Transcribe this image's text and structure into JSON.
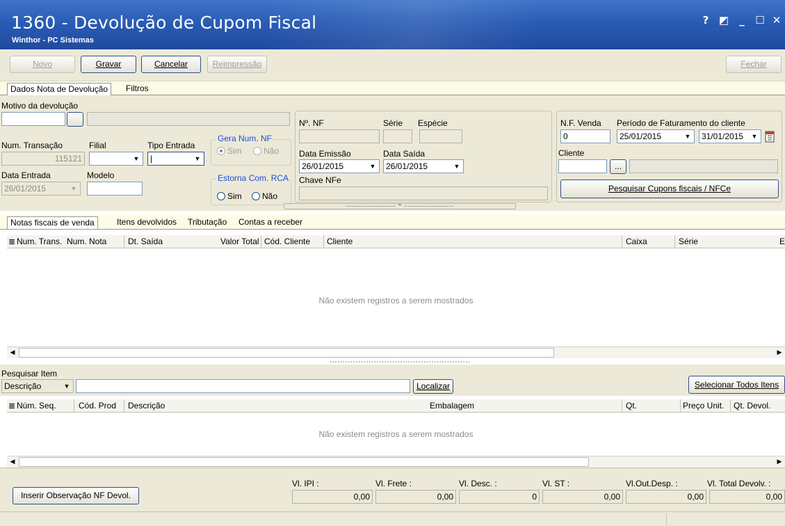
{
  "window": {
    "title": "1360 - Devolução de Cupom Fiscal",
    "subtitle": "Winthor - PC Sistemas",
    "controls": [
      "?",
      "◩",
      "_",
      "☐",
      "✕"
    ]
  },
  "toolbar": {
    "novo": "Novo",
    "gravar": "Gravar",
    "cancelar": "Cancelar",
    "reimpressao": "Reimpressão",
    "fechar": "Fechar"
  },
  "top_tabs": [
    "Dados Nota de Devolução",
    "Filtros"
  ],
  "form": {
    "motivo_label": "Motivo da devolução",
    "num_transacao_label": "Num. Transação",
    "num_transacao_value": "115121",
    "filial_label": "Filial",
    "tipo_entrada_label": "Tipo Entrada",
    "data_entrada_label": "Data Entrada",
    "data_entrada_value": "26/01/2015",
    "modelo_label": "Modelo",
    "gera_num_nf": {
      "legend": "Gera Num. NF",
      "sim": "Sim",
      "nao": "Não"
    },
    "estorna_com_rca": {
      "legend": "Estorna Com. RCA",
      "sim": "Sim",
      "nao": "Não"
    },
    "nf_label": "Nº. NF",
    "serie_label": "Série",
    "especie_label": "Espécie",
    "data_emissao_label": "Data Emissão",
    "data_emissao_value": "26/01/2015",
    "data_saida_label": "Data Saída",
    "data_saida_value": "26/01/2015",
    "chave_nfe_label": "Chave NFe",
    "nf_venda_label": "N.F. Venda",
    "nf_venda_value": "0",
    "periodo_label": "Período de Faturamento do cliente",
    "periodo_inicio": "25/01/2015",
    "periodo_fim": "31/01/2015",
    "cliente_label": "Cliente",
    "ellipsis": "...",
    "pesquisar_cupons": "Pesquisar Cupons fiscais / NFCe"
  },
  "lower_tabs": [
    "Notas fiscais de venda",
    "Itens devolvidos",
    "Tributação",
    "Contas a receber"
  ],
  "grid1": {
    "columns": [
      "Num. Trans.",
      "Num. Nota",
      "Dt. Saída",
      "Valor Total",
      "Cód. Cliente",
      "Cliente",
      "Caixa",
      "Série",
      "E"
    ],
    "empty_text": "Não existem registros a serem mostrados"
  },
  "search": {
    "label": "Pesquisar Item",
    "field_select": "Descrição",
    "localizar": "Localizar",
    "selecionar_todos": "Selecionar Todos Itens"
  },
  "grid2": {
    "columns": [
      "Núm. Seq.",
      "Cód. Prod",
      "Descrição",
      "Embalagem",
      "Qt.",
      "Preço Unit.",
      "Qt. Devol."
    ],
    "empty_text": "Não existem registros a serem mostrados"
  },
  "footer": {
    "inserir_obs": "Inserir Observação NF Devol.",
    "vl_ipi_label": "Vl. IPI :",
    "vl_ipi": "0,00",
    "vl_frete_label": "Vl. Frete :",
    "vl_frete": "0,00",
    "vl_desc_label": "Vl. Desc. :",
    "vl_desc": "0",
    "vl_st_label": "Vl. ST :",
    "vl_st": "0,00",
    "vl_out_desp_label": "Vl.Out.Desp. :",
    "vl_out_desp": "0,00",
    "vl_total_label": "Vl. Total Devolv. :",
    "vl_total": "0,00"
  },
  "colors": {
    "titlebar": "#2a5cb5",
    "panel": "#ece9d8",
    "accent_blue": "#1d4ed8"
  }
}
